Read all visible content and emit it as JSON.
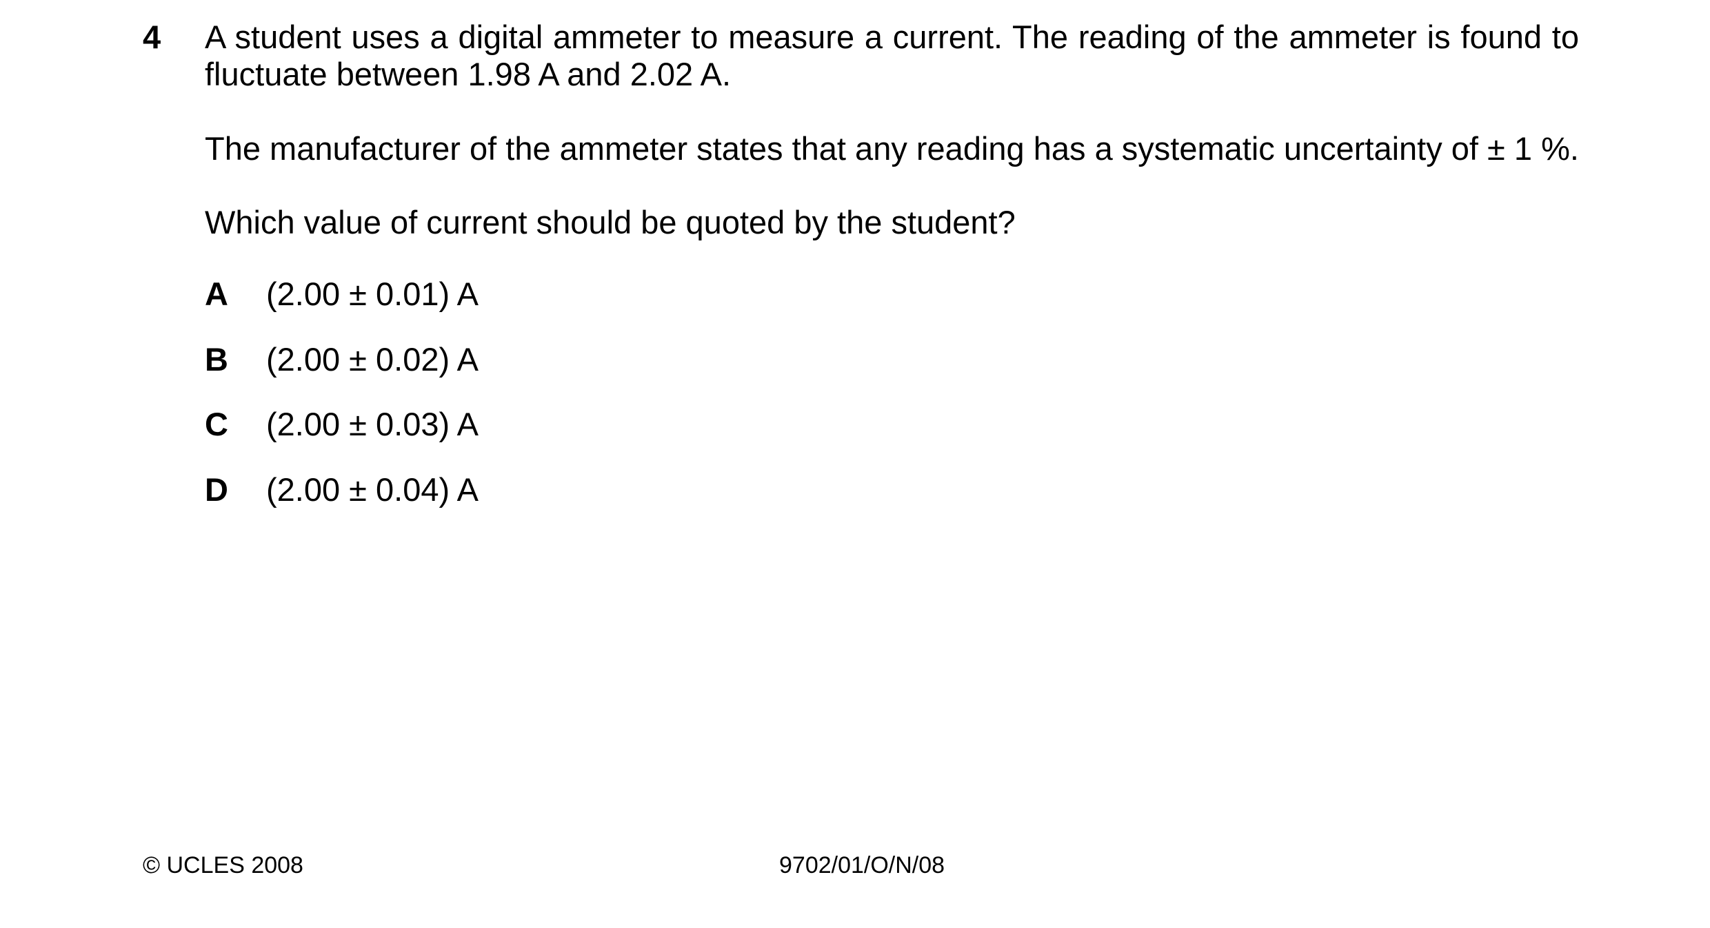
{
  "question": {
    "number": "4",
    "paragraph1": "A student uses a digital ammeter to measure a current. The reading of the ammeter is found to fluctuate between 1.98 A and 2.02 A.",
    "paragraph2": "The manufacturer of the ammeter states that any reading has a systematic uncertainty of ± 1 %.",
    "prompt": "Which value of current should be quoted by the student?"
  },
  "options": [
    {
      "letter": "A",
      "text": "(2.00 ± 0.01) A"
    },
    {
      "letter": "B",
      "text": "(2.00 ± 0.02) A"
    },
    {
      "letter": "C",
      "text": "(2.00 ± 0.03) A"
    },
    {
      "letter": "D",
      "text": "(2.00 ± 0.04) A"
    }
  ],
  "footer": {
    "copyright": "© UCLES 2008",
    "paper_code": "9702/01/O/N/08"
  }
}
